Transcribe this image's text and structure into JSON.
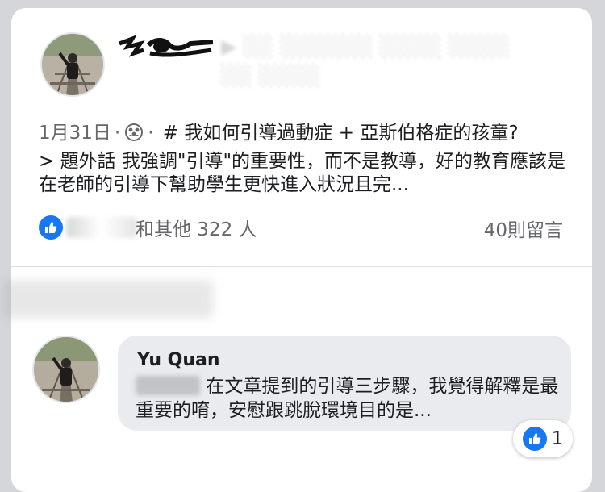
{
  "post": {
    "date": "1月31日",
    "meta_sep": "·",
    "hashtag_title": "# 我如何引導過動症 + 亞斯伯格症的孩童?",
    "excerpt": "> 題外話 我強調\"引導\"的重要性，而不是教導，好的教育應該是在老師的引導下幫助學生更快進入狀況且完...",
    "reactions_suffix": "和其他 322 人",
    "comment_count": "40則留言",
    "audience_icon": "friends-icon"
  },
  "comment": {
    "author": "Yu Quan",
    "text": "在文章提到的引導三步驟，我覺得解釋是最重要的唷，安慰跟跳脫環境目的是...",
    "like_count": "1"
  },
  "colors": {
    "brand_blue": "#1877f2",
    "secondary_text": "#65676b",
    "primary_text": "#1c1e21",
    "bubble": "#eaebee"
  }
}
